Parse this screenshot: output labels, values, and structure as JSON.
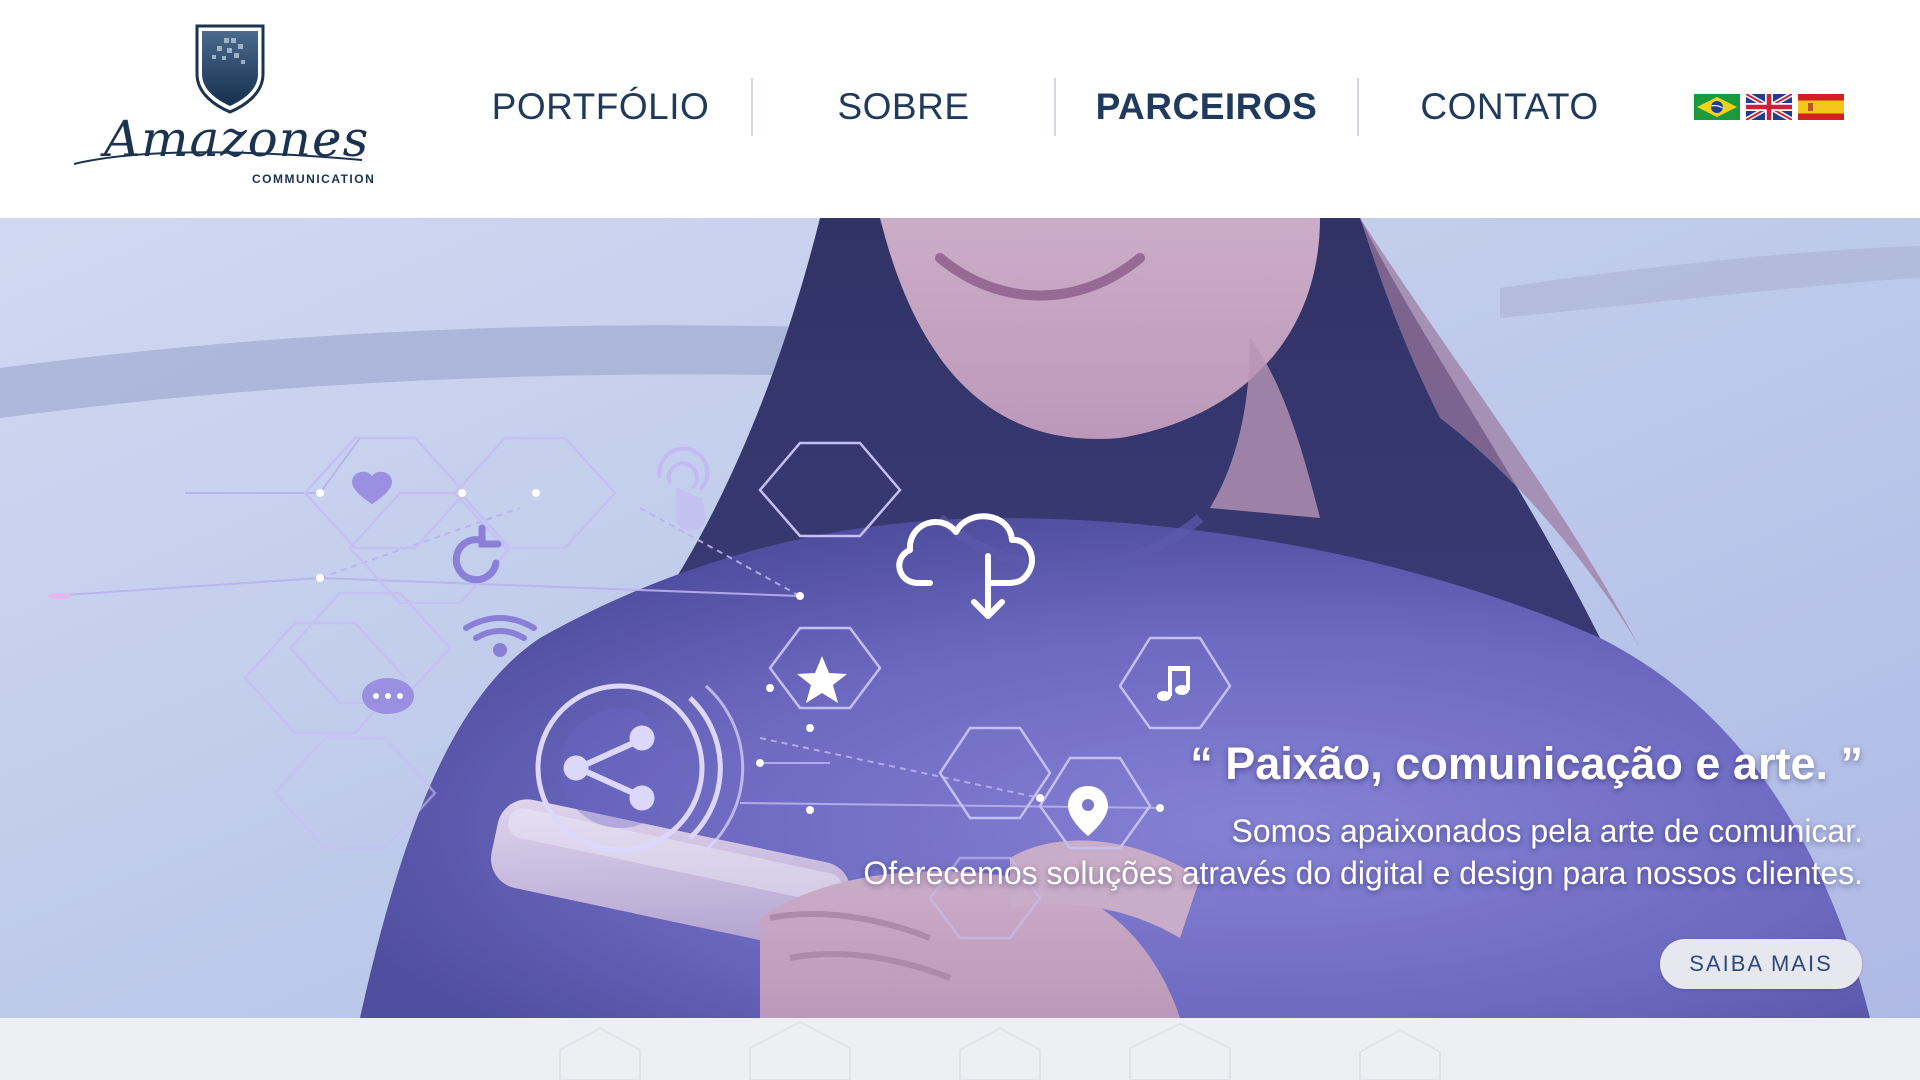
{
  "brand": {
    "name": "Amazones",
    "tagline_small": "COMMUNICATION"
  },
  "nav": {
    "items": [
      {
        "label": "PORTFÓLIO",
        "active": false
      },
      {
        "label": "SOBRE",
        "active": false
      },
      {
        "label": "PARCEIROS",
        "active": true
      },
      {
        "label": "CONTATO",
        "active": false
      }
    ]
  },
  "languages": [
    {
      "icon": "brazil-flag-icon"
    },
    {
      "icon": "uk-flag-icon"
    },
    {
      "icon": "spain-flag-icon"
    }
  ],
  "hero": {
    "headline": "“ Paixão, comunicação e arte. ”",
    "description_lines": [
      "Somos apaixonados pela arte de comunicar.",
      "Oferecemos soluções através do digital e design para nossos clientes."
    ],
    "cta_label": "SAIBA MAIS",
    "icons": [
      "heart-icon",
      "touch-icon",
      "refresh-icon",
      "wifi-icon",
      "chat-icon",
      "share-icon",
      "cloud-download-icon",
      "star-icon",
      "music-icon",
      "location-pin-icon"
    ]
  },
  "colors": {
    "nav_text": "#1f3a5c",
    "brand_navy": "#1c3350",
    "cta_background": "#e7e7ef",
    "cta_text": "#2c4a7a",
    "hero_tint": "#6a68c8"
  }
}
